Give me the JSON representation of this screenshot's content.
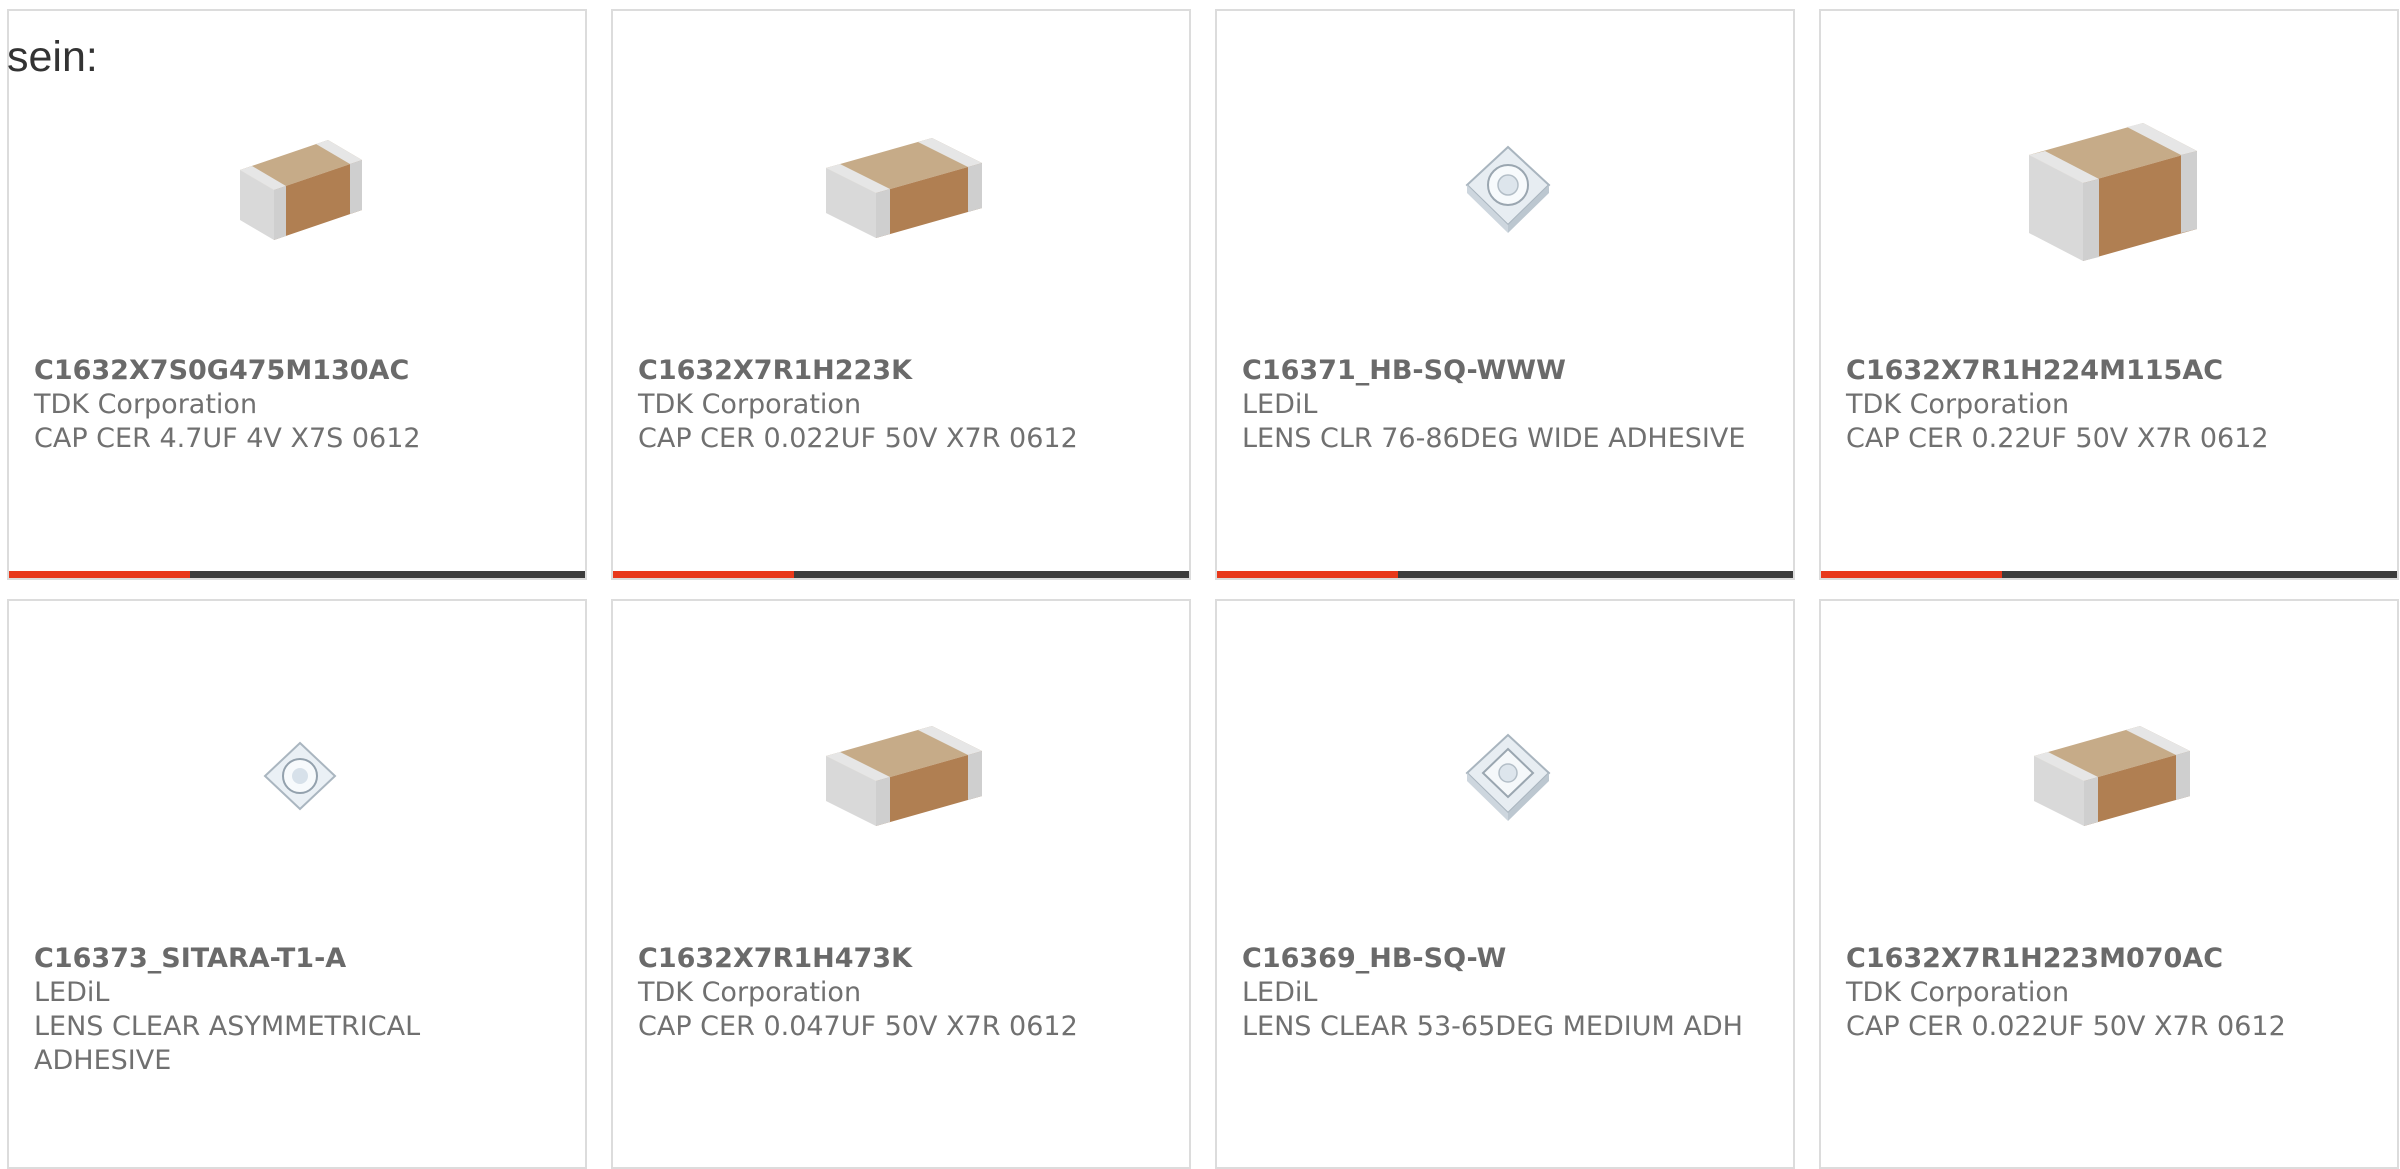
{
  "intro": {
    "text": "sein:"
  },
  "colors": {
    "accent": "#e8381b",
    "bar_track": "#3c3c3c",
    "border": "#dcdcdc",
    "text": "#707070"
  },
  "products": [
    {
      "part_number": "C1632X7S0G475M130AC",
      "manufacturer": "TDK Corporation",
      "description": "CAP CER 4.7UF 4V X7S 0612",
      "image_icon": "ceramic-capacitor-icon",
      "progress": 0.31
    },
    {
      "part_number": "C1632X7R1H223K",
      "manufacturer": "TDK Corporation",
      "description": "CAP CER 0.022UF 50V X7R 0612",
      "image_icon": "ceramic-capacitor-icon",
      "progress": 0.31
    },
    {
      "part_number": "C16371_HB-SQ-WWW",
      "manufacturer": "LEDiL",
      "description": "LENS CLR 76-86DEG WIDE ADHESIVE",
      "image_icon": "led-lens-icon",
      "progress": 0.31
    },
    {
      "part_number": "C1632X7R1H224M115AC",
      "manufacturer": "TDK Corporation",
      "description": "CAP CER 0.22UF 50V X7R 0612",
      "image_icon": "ceramic-capacitor-icon",
      "progress": 0.31
    },
    {
      "part_number": "C16373_SITARA-T1-A",
      "manufacturer": "LEDiL",
      "description": "LENS CLEAR ASYMMETRICAL ADHESIVE",
      "image_icon": "led-lens-icon",
      "progress": null
    },
    {
      "part_number": "C1632X7R1H473K",
      "manufacturer": "TDK Corporation",
      "description": "CAP CER 0.047UF 50V X7R 0612",
      "image_icon": "ceramic-capacitor-icon",
      "progress": null
    },
    {
      "part_number": "C16369_HB-SQ-W",
      "manufacturer": "LEDiL",
      "description": "LENS CLEAR 53-65DEG MEDIUM ADH",
      "image_icon": "led-lens-icon",
      "progress": null
    },
    {
      "part_number": "C1632X7R1H223M070AC",
      "manufacturer": "TDK Corporation",
      "description": "CAP CER 0.022UF 50V X7R 0612",
      "image_icon": "ceramic-capacitor-icon",
      "progress": null
    }
  ]
}
